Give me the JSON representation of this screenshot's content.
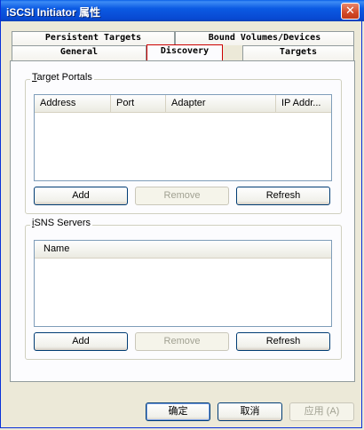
{
  "window": {
    "title": "iSCSI Initiator 属性",
    "close_glyph": "✕"
  },
  "tabs": {
    "row1": [
      "Persistent Targets",
      "Bound Volumes/Devices"
    ],
    "row2": [
      "General",
      "Discovery",
      "Targets"
    ],
    "active": "Discovery"
  },
  "target_portals": {
    "label": "Target Portals",
    "columns": [
      "Address",
      "Port",
      "Adapter",
      "IP Addr..."
    ],
    "buttons": {
      "add": "Add",
      "remove": "Remove",
      "refresh": "Refresh"
    }
  },
  "isns_servers": {
    "label": "iSNS Servers",
    "columns": [
      "Name"
    ],
    "buttons": {
      "add": "Add",
      "remove": "Remove",
      "refresh": "Refresh"
    }
  },
  "footer": {
    "ok": "确定",
    "cancel": "取消",
    "apply": "应用 (A)"
  },
  "colors": {
    "title_bar": "#0b5ae3",
    "dialog_bg": "#ece9d8",
    "active_tab_border": "#cc0000"
  }
}
